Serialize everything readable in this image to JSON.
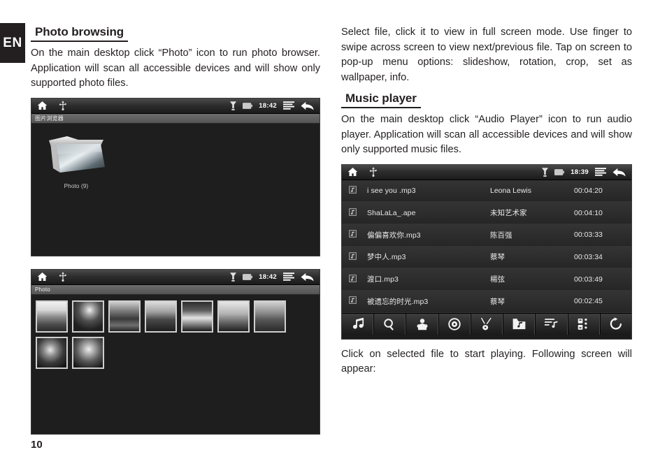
{
  "language_tab": "EN",
  "page_number": "10",
  "left_column": {
    "section_title": "Photo browsing",
    "paragraph": "On the main desktop click “Photo” icon to run photo browser. Application will scan all accessible devices and will show only supported photo files."
  },
  "right_column": {
    "intro_paragraph": "Select file, click it to view in full screen mode. Use finger to swipe across screen to view next/previous file. Tap on screen to pop-up menu options: slideshow, rotation, crop, set as wallpaper, info.",
    "section_title": "Music player",
    "paragraph": "On the main desktop click “Audio Player” icon to run audio player. Application will scan all accessible devices and will show only supported music files.",
    "closing_paragraph": "Click on selected file to start playing. Following screen will appear:"
  },
  "photo_folder_screen": {
    "statusbar": {
      "home_icon": "home-icon",
      "usb_icon": "usb-icon",
      "signal_icon": "signal-icon",
      "battery_icon": "battery-icon",
      "time": "18:42",
      "menu_icon": "menu-icon",
      "back_icon": "back-arrow-icon"
    },
    "breadcrumb": "图片浏览器",
    "folder": {
      "icon": "folder-icon",
      "label": "Photo (9)"
    }
  },
  "photo_thumbs_screen": {
    "statusbar": {
      "home_icon": "home-icon",
      "usb_icon": "usb-icon",
      "signal_icon": "signal-icon",
      "battery_icon": "battery-icon",
      "time": "18:42",
      "menu_icon": "menu-icon",
      "back_icon": "back-arrow-icon"
    },
    "breadcrumb": "Photo",
    "thumbnail_count": 9,
    "thumbnails": [
      {
        "id": "thumb-1",
        "desc": "lakeside-village"
      },
      {
        "id": "thumb-2",
        "desc": "planet-over-field"
      },
      {
        "id": "thumb-3",
        "desc": "clouded-sky-field"
      },
      {
        "id": "thumb-4",
        "desc": "storm-over-plain"
      },
      {
        "id": "thumb-5",
        "desc": "car-on-road"
      },
      {
        "id": "thumb-6",
        "desc": "beach-surf"
      },
      {
        "id": "thumb-7",
        "desc": "village-panorama"
      },
      {
        "id": "thumb-8",
        "desc": "avatar-character"
      },
      {
        "id": "thumb-9",
        "desc": "archer-portrait"
      }
    ]
  },
  "music_screen": {
    "statusbar": {
      "home_icon": "home-icon",
      "usb_icon": "usb-icon",
      "signal_icon": "signal-icon",
      "battery_icon": "battery-icon",
      "time": "18:39",
      "menu_icon": "menu-icon",
      "back_icon": "back-arrow-icon"
    },
    "tracks": [
      {
        "icon": "music-file-icon",
        "title": "i see you .mp3",
        "artist": "Leona Lewis",
        "duration": "00:04:20"
      },
      {
        "icon": "music-file-icon",
        "title": "ShaLaLa_.ape",
        "artist": "未知艺术家",
        "duration": "00:04:10"
      },
      {
        "icon": "music-file-icon",
        "title": "偏偏喜欢你.mp3",
        "artist": "陈百强",
        "duration": "00:03:33"
      },
      {
        "icon": "music-file-icon",
        "title": "梦中人.mp3",
        "artist": "蔡琴",
        "duration": "00:03:34"
      },
      {
        "icon": "music-file-icon",
        "title": "渡口.mp3",
        "artist": "楊弦",
        "duration": "00:03:49"
      },
      {
        "icon": "music-file-icon",
        "title": "被遗忘的时光.mp3",
        "artist": "蔡琴",
        "duration": "00:02:45"
      }
    ],
    "toolbar": [
      {
        "icon": "music-note-icon",
        "name": "songs"
      },
      {
        "icon": "search-icon",
        "name": "search"
      },
      {
        "icon": "artist-icon",
        "name": "artists"
      },
      {
        "icon": "album-disc-icon",
        "name": "albums"
      },
      {
        "icon": "guitar-icon",
        "name": "genres"
      },
      {
        "icon": "media-folder-icon",
        "name": "folders"
      },
      {
        "icon": "playlist-icon",
        "name": "playlist"
      },
      {
        "icon": "equalizer-icon",
        "name": "equalizer"
      },
      {
        "icon": "repeat-icon",
        "name": "refresh"
      }
    ]
  },
  "colors": {
    "ink": "#231f20",
    "device_bg": "#1e1e1e",
    "statusbar_top": "#4a4a4a",
    "breadcrumb": "#5d5d5d"
  }
}
